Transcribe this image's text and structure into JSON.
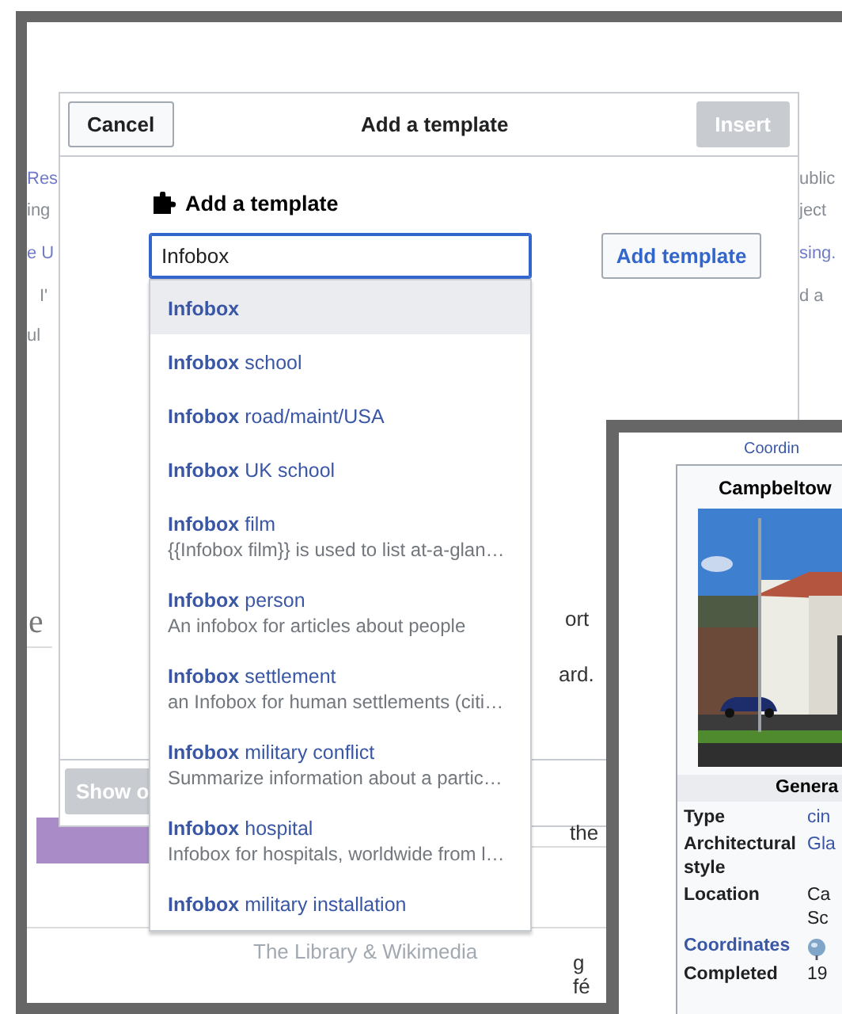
{
  "background_page": {
    "left_fragments": [
      {
        "text": "Res",
        "link": true
      },
      {
        "text": "ing",
        "link": false
      },
      {
        "text": "e U",
        "link": true
      },
      {
        "text": "I'",
        "link": false
      },
      {
        "text": "ul",
        "link": false
      }
    ],
    "right_fragments": [
      {
        "text": "ublic",
        "link": false
      },
      {
        "text": "ject",
        "link": false
      },
      {
        "text": "sing.",
        "link": true
      },
      {
        "text": "d a",
        "link": false
      }
    ],
    "heading_fragment": "e",
    "side_fragments": [
      "ort",
      "ard.",
      "the",
      "g",
      "fé"
    ],
    "footer": "The Library & Wikimedia"
  },
  "dialog": {
    "title": "Add a template",
    "cancel": "Cancel",
    "insert": {
      "label": "Insert",
      "disabled": true
    },
    "heading": "Add a template",
    "search": {
      "value": "Infobox"
    },
    "add_button": "Add template",
    "footer_button": {
      "label": "Show o",
      "disabled": true
    },
    "suggestions": [
      {
        "name": "**Infobox**",
        "selected": true
      },
      {
        "name": "**Infobox** school",
        "selected": false
      },
      {
        "name": "**Infobox** road/maint/USA",
        "selected": false
      },
      {
        "name": "**Infobox** UK school",
        "selected": false
      },
      {
        "name": "**Infobox** film",
        "description": "{{Infobox film}} is used to list at-a-glan…",
        "selected": false
      },
      {
        "name": "**Infobox** person",
        "description": "An infobox for articles about people",
        "selected": false
      },
      {
        "name": "**Infobox** settlement",
        "description": "an Infobox for human settlements (citi…",
        "selected": false
      },
      {
        "name": "**Infobox** military conflict",
        "description": "Summarize information about a partic…",
        "selected": false
      },
      {
        "name": "**Infobox** hospital",
        "description": "Infobox for hospitals, worldwide from l…",
        "selected": false
      },
      {
        "name": "**Infobox** military installation",
        "selected": false
      }
    ]
  },
  "second_screenshot": {
    "coordinates_link": "Coordin",
    "infobox": {
      "title": "Campbeltow",
      "section": "Genera",
      "rows": [
        {
          "kind": "text",
          "label": "Type",
          "label_link": false,
          "values": [
            {
              "text": "cin",
              "link": true
            }
          ]
        },
        {
          "kind": "text",
          "label": "Architectural style",
          "label_link": false,
          "values": [
            {
              "text": "Gla",
              "link": true
            }
          ]
        },
        {
          "kind": "text",
          "label": "Location",
          "label_link": false,
          "values": [
            {
              "text": "Ca",
              "link": false
            },
            {
              "text": "Sc",
              "link": false
            }
          ]
        },
        {
          "kind": "globe",
          "label": "Coordinates",
          "label_link": true
        },
        {
          "kind": "text",
          "label": "Completed",
          "label_link": false,
          "values": [
            {
              "text": "19",
              "link": false
            }
          ]
        }
      ]
    }
  }
}
